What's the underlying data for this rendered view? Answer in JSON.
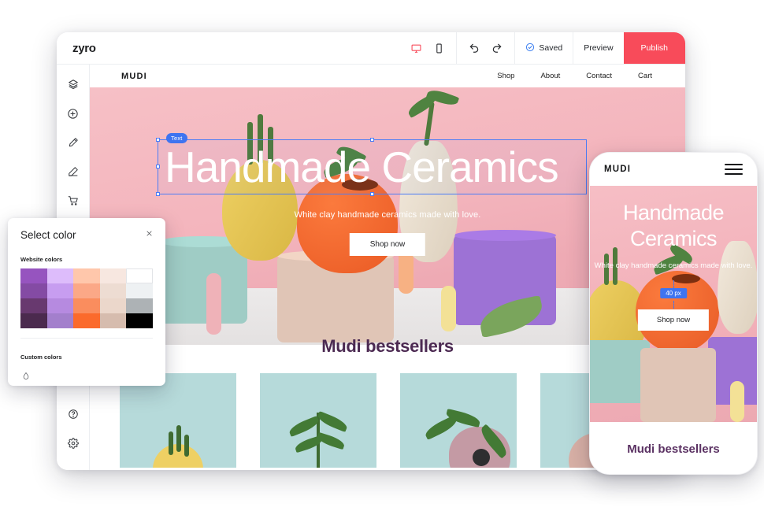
{
  "builder": {
    "logo": "zyro",
    "toolbar": {
      "desktop_icon": "desktop-icon",
      "mobile_icon": "mobile-icon",
      "undo_icon": "undo-icon",
      "redo_icon": "redo-icon",
      "saved_label": "Saved",
      "saved_icon": "check-circle-icon",
      "preview_label": "Preview",
      "publish_label": "Publish",
      "publish_color": "#f84b5a",
      "active_view": "desktop",
      "active_view_color": "#f84b5a"
    },
    "sidebar": {
      "items": [
        {
          "icon": "layers-icon",
          "name": "layers"
        },
        {
          "icon": "plus-circle-icon",
          "name": "add-element"
        },
        {
          "icon": "brush-icon",
          "name": "styles"
        },
        {
          "icon": "pencil-icon",
          "name": "edit"
        },
        {
          "icon": "cart-icon",
          "name": "store"
        }
      ],
      "bottom_items": [
        {
          "icon": "help-circle-icon",
          "name": "help"
        },
        {
          "icon": "gear-icon",
          "name": "settings"
        }
      ]
    }
  },
  "site": {
    "logo": "MUDI",
    "nav": [
      "Shop",
      "About",
      "Contact",
      "Cart"
    ],
    "hero": {
      "title": "Handmade Ceramics",
      "subtitle": "White clay handmade ceramics made with love.",
      "cta": "Shop now",
      "selection_tag": "Text"
    },
    "section": {
      "title": "Mudi bestsellers"
    }
  },
  "color_dialog": {
    "title": "Select color",
    "close_icon": "close-icon",
    "website_colors_label": "Website colors",
    "custom_colors_label": "Custom colors",
    "add_custom_icon": "color-picker-icon",
    "swatches": [
      "#9654bf",
      "#ddbcfb",
      "#ffc7ab",
      "#f7e7e0",
      "#ffffff",
      "#844ba4",
      "#c79df0",
      "#fba887",
      "#eddcd2",
      "#eef1f3",
      "#68396f",
      "#b68ae0",
      "#fa8d5e",
      "#ebd7cb",
      "#adb2b5",
      "#4b2a4e",
      "#a37fcc",
      "#fb6a2c",
      "#d6bcae",
      "#000000"
    ]
  },
  "mobile": {
    "logo": "MUDI",
    "menu_icon": "hamburger-icon",
    "title": "Handmade Ceramics",
    "subtitle": "White clay handmade ceramics made with love.",
    "spacing_badge": "40 px",
    "cta": "Shop now",
    "section_title": "Mudi bestsellers"
  }
}
